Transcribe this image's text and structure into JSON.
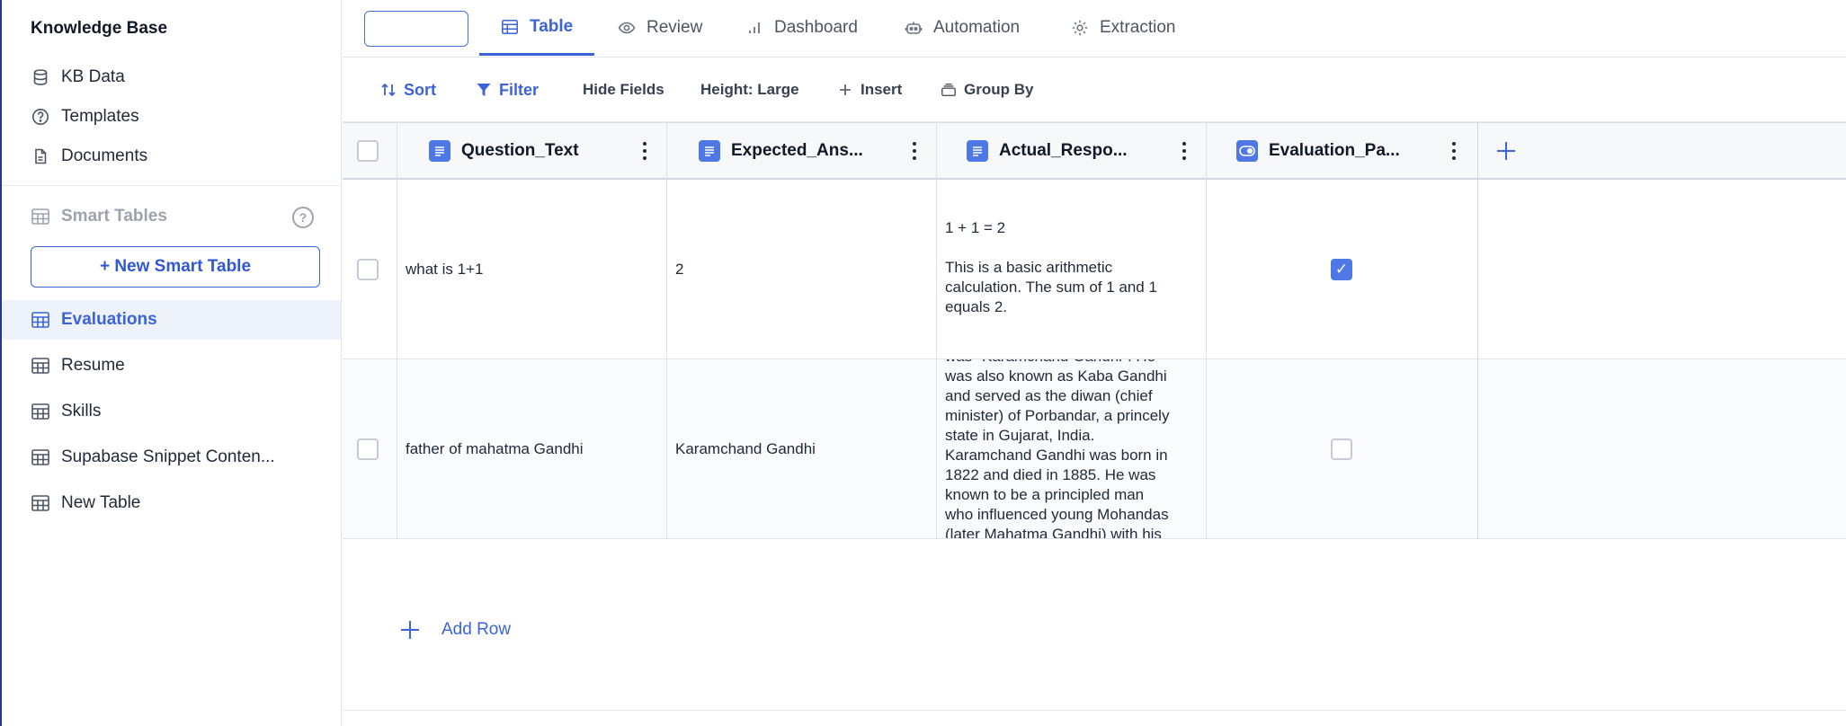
{
  "sidebar": {
    "title": "Knowledge Base",
    "items": [
      {
        "label": "KB Data",
        "icon": "database-icon"
      },
      {
        "label": "Templates",
        "icon": "question-circle-icon"
      },
      {
        "label": "Documents",
        "icon": "document-icon"
      }
    ],
    "section_title": "Smart Tables",
    "help_glyph": "?",
    "new_button": "+ New Smart Table",
    "tables": [
      {
        "label": "Evaluations",
        "active": true
      },
      {
        "label": "Resume"
      },
      {
        "label": "Skills"
      },
      {
        "label": "Supabase Snippet Conten..."
      },
      {
        "label": "New Table"
      }
    ]
  },
  "tabs": [
    {
      "label": "Table",
      "icon": "table-icon",
      "active": true
    },
    {
      "label": "Review",
      "icon": "eye-icon"
    },
    {
      "label": "Dashboard",
      "icon": "bar-chart-icon"
    },
    {
      "label": "Automation",
      "icon": "robot-icon"
    },
    {
      "label": "Extraction",
      "icon": "gear-icon"
    }
  ],
  "toolbar": {
    "sort": "Sort",
    "filter": "Filter",
    "hide_fields": "Hide Fields",
    "height": "Height: Large",
    "insert": "Insert",
    "group_by": "Group By"
  },
  "columns": [
    {
      "title": "Question_Text",
      "type": "text"
    },
    {
      "title": "Expected_Ans...",
      "type": "text"
    },
    {
      "title": "Actual_Respo...",
      "type": "text"
    },
    {
      "title": "Evaluation_Pa...",
      "type": "toggle"
    }
  ],
  "rows": [
    {
      "question": "what is 1+1",
      "expected": "2",
      "actual_lines": [
        "1 + 1 = 2",
        "",
        "This is a basic arithmetic",
        "calculation. The sum of 1 and 1",
        "equals 2."
      ],
      "passed": true
    },
    {
      "question": "father of mahatma Gandhi",
      "expected": "Karamchand Gandhi",
      "actual_lines": [
        "was \"Karamchand Gandhi\". He",
        "was also known as Kaba Gandhi",
        "and served as the diwan (chief",
        "minister) of Porbandar, a princely",
        "state in Gujarat, India.",
        "Karamchand Gandhi was born in",
        "1822 and died in 1885. He was",
        "known to be a principled man",
        "who influenced young Mohandas",
        "(later Mahatma Gandhi) with his"
      ],
      "passed": false
    }
  ],
  "add_row": "Add Row",
  "colors": {
    "accent": "#3c63d8",
    "active_bg": "#eef3fb",
    "checkbox_on": "#4d78e6"
  }
}
